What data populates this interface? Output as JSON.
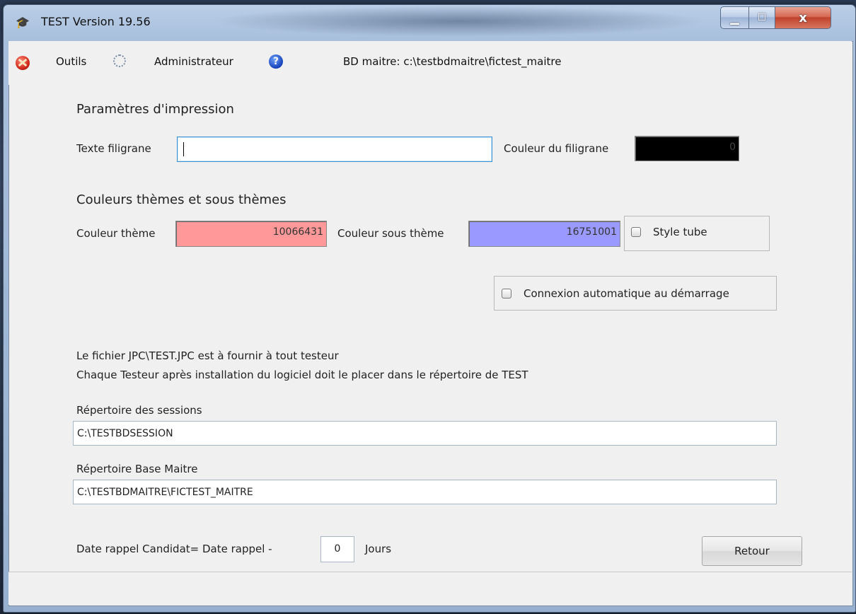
{
  "window": {
    "title": "TEST Version 19.56",
    "controls": {
      "minimize": "▁",
      "maximize": "☐",
      "close": "x"
    }
  },
  "menubar": {
    "items": [
      {
        "name": "outils",
        "label": "Outils",
        "icon": "tools-icon"
      },
      {
        "name": "administrateur",
        "label": "Administrateur",
        "icon": "refresh-icon"
      },
      {
        "name": "help",
        "label": "",
        "icon": "help-icon"
      }
    ],
    "bd_maitre": "BD maitre: c:\\testbdmaitre\\fictest_maitre"
  },
  "impression": {
    "title": "Paramètres d'impression",
    "texte_filigrane_label": "Texte filigrane",
    "texte_filigrane_value": "",
    "couleur_filigrane_label": "Couleur du filigrane",
    "couleur_filigrane_value": "0",
    "couleur_filigrane_color": "#000000"
  },
  "couleurs": {
    "title": "Couleurs thèmes et sous thèmes",
    "theme_label": "Couleur thème",
    "theme_value": "10066431",
    "theme_color": "#ff9999",
    "sous_theme_label": "Couleur sous thème",
    "sous_theme_value": "16751001",
    "sous_theme_color": "#9999ff",
    "style_tube_label": "Style tube",
    "style_tube_checked": false
  },
  "connexion_auto": {
    "label": "Connexion automatique au démarrage",
    "checked": false
  },
  "info": {
    "line1": "Le fichier JPC\\TEST.JPC est à fournir à tout testeur",
    "line2": "Chaque Testeur après installation du logiciel doit  le placer dans  le répertoire de TEST"
  },
  "repertoire_sessions": {
    "label": "Répertoire des sessions",
    "value": "C:\\TESTBDSESSION"
  },
  "repertoire_base": {
    "label": "Répertoire Base Maitre",
    "value": "C:\\TESTBDMAITRE\\FICTEST_MAITRE"
  },
  "rappel": {
    "label": "Date rappel Candidat= Date rappel  -",
    "value": "0",
    "unit": "Jours"
  },
  "buttons": {
    "retour": "Retour"
  }
}
